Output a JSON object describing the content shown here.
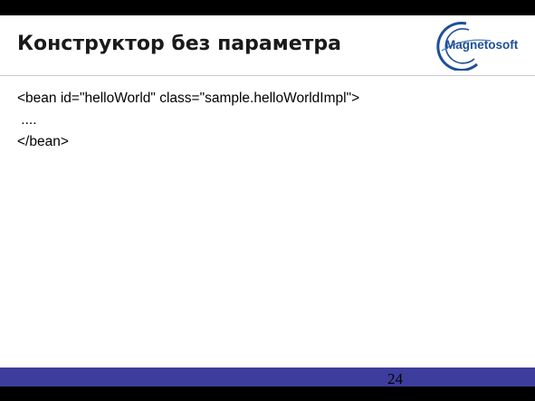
{
  "slide": {
    "title": "Конструктор без параметра",
    "logo_text": "Magnetosoft",
    "code_lines": [
      "<bean id=\"helloWorld\" class=\"sample.helloWorldImpl\">",
      " ....",
      "</bean>"
    ],
    "page_number": "24"
  },
  "colors": {
    "footer_band": "#3d3d9e",
    "logo_blue": "#1f4f9a",
    "top_bar": "#000000"
  },
  "icons": {
    "logo": "magnetosoft-logo-icon"
  }
}
